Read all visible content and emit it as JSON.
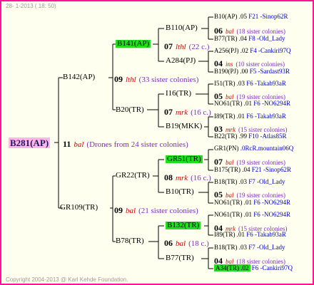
{
  "header": {
    "date": "28- 1-2013 ( 18: 50)"
  },
  "footer": {
    "copyright": "Copyright 2004-2013 @ Karl Kehde Foundation."
  },
  "colors": {
    "border": "#ff1493",
    "highlight": "#22dd22",
    "root_bg": "#ffb6e6",
    "note": "#7a2bbd",
    "mark": "#dd0000",
    "source": "#0000cc"
  },
  "tree": {
    "root": "B281(AP)",
    "root_gen": "11",
    "root_mark": "bal",
    "root_note": "(Drones from 24 sister colonies)",
    "g1a": "B142(AP)",
    "g1a_gen": "09",
    "g1a_mark": "lthl",
    "g1a_note": "(33 sister colonies)",
    "g1b": "GR109(TR)",
    "g1b_gen": "09",
    "g1b_mark": "bal",
    "g1b_note": "(21 sister colonies)",
    "g2a": "B141(AP)",
    "g2a_gen": "07",
    "g2a_mark": "lthl",
    "g2a_note": "(22 c.)",
    "g2b": "B20(TR)",
    "g2b_gen": "07",
    "g2b_mark": "mrk",
    "g2b_note": "(16 c.)",
    "g2c": "GR22(TR)",
    "g2c_gen": "08",
    "g2c_mark": "mrk",
    "g2c_note": "(16 c.)",
    "g2d": "B78(TR)",
    "g2d_gen": "06",
    "g2d_mark": "bal",
    "g2d_note": "(18 c.)",
    "g3a": "B110(AP)",
    "g3a_gen": "06",
    "g3a_mark": "bal",
    "g3a_note": "(18 sister colonies)",
    "g3b": "A284(PJ)",
    "g3b_gen": "04",
    "g3b_mark": "ins",
    "g3b_note": "(10 sister colonies)",
    "g3c": "I16(TR)",
    "g3c_gen": "05",
    "g3c_mark": "bal",
    "g3c_note": "(19 sister colonies)",
    "g3d": "B19(MKK)",
    "g3d_gen": "03",
    "g3d_mark": "mrk",
    "g3d_note": "(15 sister colonies)",
    "g3e": "GR51(TR)",
    "g3e_gen": "07",
    "g3e_mark": "bal",
    "g3e_note": "(19 sister colonies)",
    "g3f": "B10(TR)",
    "g3f_gen": "05",
    "g3f_mark": "bal",
    "g3f_note": "(19 sister colonies)",
    "g3g": "B132(TR)",
    "g3g_gen": "04",
    "g3g_mark": "mrk",
    "g3g_note": "(15 sister colonies)",
    "g3h": "B77(TR)",
    "g3h_gen": "04",
    "g3h_mark": "bal",
    "g3h_note": "(18 sister colonies)"
  },
  "leaves": [
    {
      "id": "B10(AP)",
      "val": ".05",
      "src": "F21 -Sinop62R"
    },
    {
      "id": "B77(TR)",
      "val": ".04",
      "src": "F8 -Old_Lady"
    },
    {
      "id": "A256(PJ)",
      "val": ".02",
      "src": "F4 -Cankiri97Q"
    },
    {
      "id": "B190(PJ)",
      "val": ".00",
      "src": "F5 -Sardast93R"
    },
    {
      "id": "I51(TR)",
      "val": ".03",
      "src": "F6 -Takab93aR"
    },
    {
      "id": "NO61(TR)",
      "val": ".01",
      "src": "F6 -NO6294R"
    },
    {
      "id": "I89(TR)",
      "val": ".01",
      "src": "F6 -Takab93aR"
    },
    {
      "id": "B22(TR)",
      "val": ".99",
      "src": "F10 -Atlas85R"
    },
    {
      "id": "GR1(PN)",
      "val": "",
      "src": ".0RcR.mountain06Q"
    },
    {
      "id": "B175(TR)",
      "val": ".04",
      "src": "F21 -Sinop62R"
    },
    {
      "id": "B18(TR)",
      "val": ".03",
      "src": "F7 -Old_Lady"
    },
    {
      "id": "NO61(TR)",
      "val": ".01",
      "src": "F6 -NO6294R"
    },
    {
      "id": "NO61(TR)",
      "val": ".01",
      "src": "F6 -NO6294R"
    },
    {
      "id": "I89(TR)",
      "val": ".01",
      "src": "F6 -Takab93aR"
    },
    {
      "id": "B18(TR)",
      "val": ".03",
      "src": "F7 -Old_Lady"
    },
    {
      "idval": "A34(TR) .02",
      "src": "F6 -Cankiri97Q"
    }
  ]
}
